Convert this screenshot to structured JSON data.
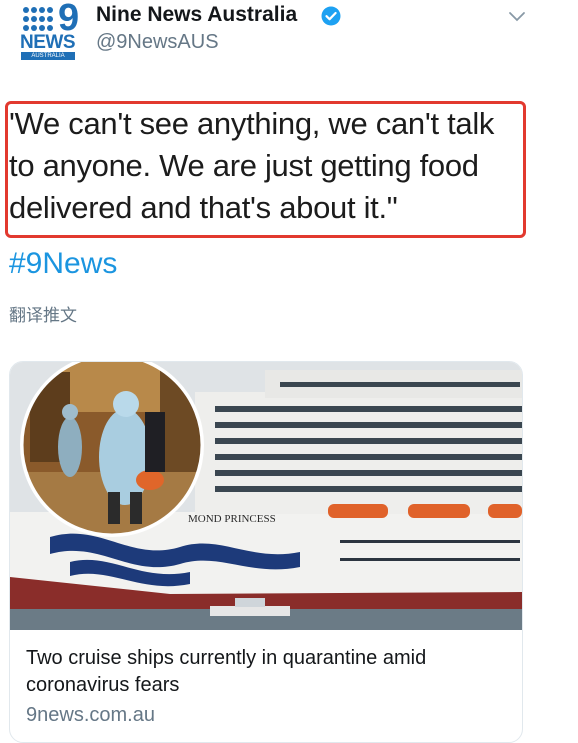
{
  "account": {
    "logo_number": "9",
    "logo_word": "NEWS",
    "logo_country": "AUSTRALIA",
    "name": "Nine News Australia",
    "handle": "@9NewsAUS"
  },
  "tweet": {
    "lines": [
      "'We can't see anything, we can't talk",
      "to anyone. We are just getting food",
      "delivered and that's about it.\""
    ],
    "hashtag": "#9News",
    "translate_label": "翻译推文"
  },
  "card": {
    "ship_name": "MOND PRINCESS",
    "title_lines": [
      "Two cruise ships currently in quarantine amid",
      "coronavirus fears"
    ],
    "domain": "9news.com.au"
  },
  "colors": {
    "brand_blue": "#1f6fb6",
    "link_blue": "#1b95e0",
    "highlight_red": "#e2392f",
    "muted_gray": "#657786"
  },
  "icons": {
    "verified": "verified-badge-icon",
    "menu": "chevron-down-icon"
  }
}
